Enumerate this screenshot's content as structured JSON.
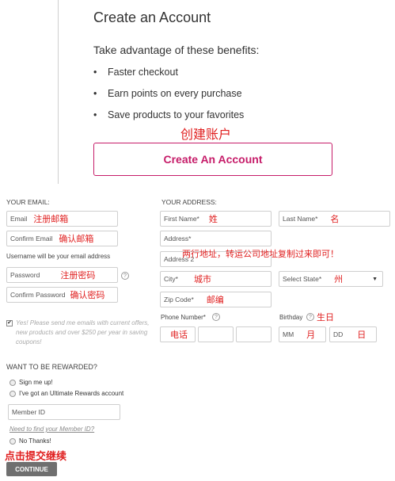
{
  "header": {
    "title": "Create an Account",
    "subtitle": "Take advantage of these benefits:",
    "benefits": [
      "Faster checkout",
      "Earn points on every purchase",
      "Save products to your favorites"
    ],
    "cta_annotation": "创建账户",
    "cta_label": "Create An Account",
    "accent_color": "#c61c69"
  },
  "email_section": {
    "heading": "YOUR EMAIL:",
    "email_placeholder": "Email",
    "email_note": "注册邮箱",
    "confirm_email_placeholder": "Confirm Email",
    "confirm_email_note": "确认邮箱",
    "username_note": "Username will be your email address",
    "password_placeholder": "Password",
    "password_note": "注册密码",
    "confirm_password_placeholder": "Confirm Password",
    "confirm_password_note": "确认密码",
    "optin_text": "Yes! Please send me emails with current offers, new products and over $250 per year in saving coupons!"
  },
  "address_section": {
    "heading": "YOUR ADDRESS:",
    "first_name": "First Name*",
    "first_name_note": "姓",
    "last_name": "Last Name*",
    "last_name_note": "名",
    "address": "Address*",
    "address2": "Address 2",
    "address_note": "两行地址，转运公司地址复制过来即可！",
    "city": "City*",
    "city_note": "城市",
    "state": "Select State*",
    "state_note": "州",
    "zip": "Zip Code*",
    "zip_note": "邮编",
    "phone_label": "Phone Number*",
    "phone_note": "电话",
    "birthday_label": "Birthday",
    "birthday_note": "生日",
    "month_placeholder": "MM",
    "month_note": "月",
    "day_placeholder": "DD",
    "day_note": "日"
  },
  "rewards": {
    "heading": "WANT TO BE REWARDED?",
    "option_signup": "Sign me up!",
    "option_have_account": "I've got an Ultimate Rewards account",
    "member_id_placeholder": "Member ID",
    "find_member_link": "Need to find your Member ID?",
    "option_no": "No Thanks!"
  },
  "footer": {
    "submit_annotation": "点击提交继续",
    "continue_label": "CONTINUE"
  }
}
